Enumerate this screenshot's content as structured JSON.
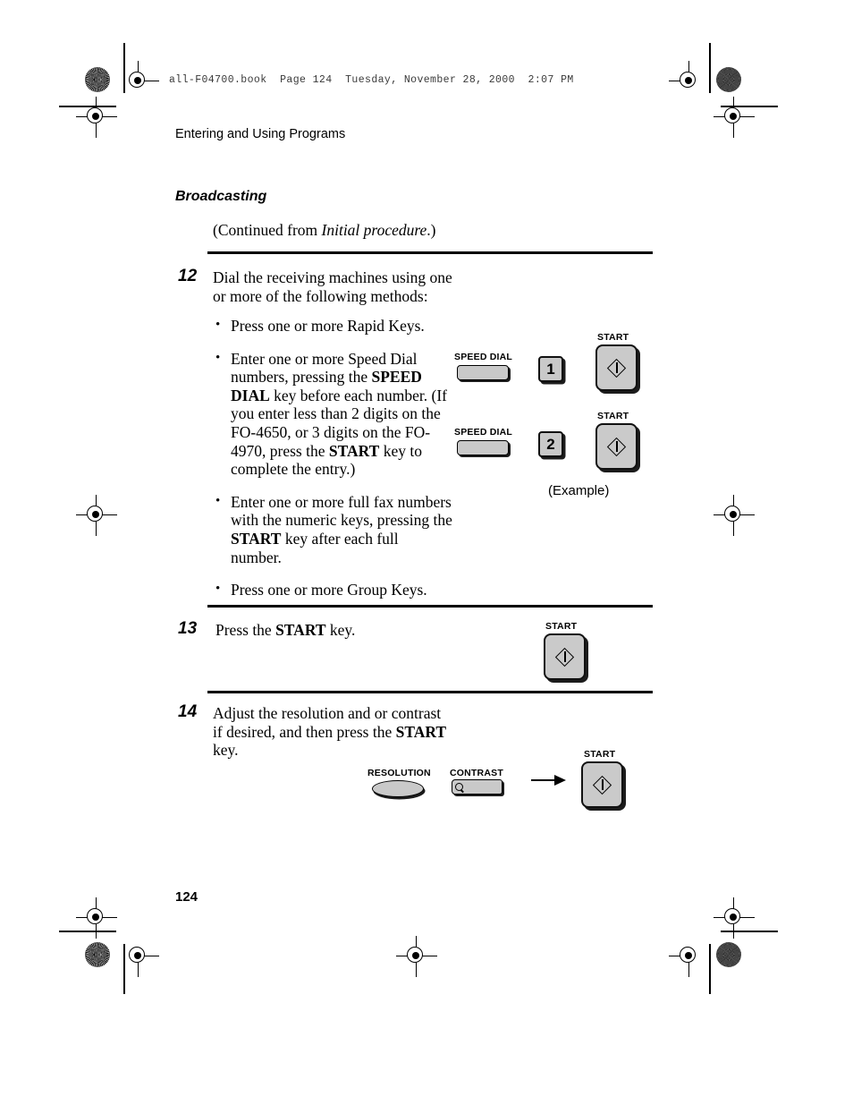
{
  "print_header": "all-F04700.book  Page 124  Tuesday, November 28, 2000  2:07 PM",
  "running_head": "Entering and Using Programs",
  "section_title": "Broadcasting",
  "continued_note": {
    "prefix": "(Continued from ",
    "italic": "Initial procedure",
    "suffix": ".)"
  },
  "folio": "124",
  "steps": [
    {
      "number": "12",
      "lead_line_1": "Dial the receiving machines using one",
      "lead_line_2": "or more of the following methods:",
      "bullets": [
        {
          "parts": [
            {
              "text": "Press one or more Rapid Keys.",
              "bold": false
            }
          ]
        },
        {
          "parts": [
            {
              "text": "Enter one or more Speed Dial numbers, pressing the ",
              "bold": false
            },
            {
              "text": "SPEED DIAL",
              "bold": true
            },
            {
              "text": " key before each number. (If you enter less than 2 digits on the FO-4650, or 3 digits on the FO-4970, press the ",
              "bold": false
            },
            {
              "text": "START",
              "bold": true
            },
            {
              "text": " key to complete the entry.)",
              "bold": false
            }
          ]
        },
        {
          "parts": [
            {
              "text": "Enter one or more full fax numbers with the numeric keys, pressing the ",
              "bold": false
            },
            {
              "text": "START",
              "bold": true
            },
            {
              "text": " key after each full number.",
              "bold": false
            }
          ]
        },
        {
          "parts": [
            {
              "text": "Press one or more Group Keys.",
              "bold": false
            }
          ]
        }
      ]
    },
    {
      "number": "13",
      "parts": [
        {
          "text": "Press the ",
          "bold": false
        },
        {
          "text": "START",
          "bold": true
        },
        {
          "text": " key.",
          "bold": false
        }
      ]
    },
    {
      "number": "14",
      "parts": [
        {
          "text": "Adjust the resolution and or contrast if desired, and then press the ",
          "bold": false
        },
        {
          "text": "START",
          "bold": true
        },
        {
          "text": " key.",
          "bold": false
        }
      ]
    }
  ],
  "keys": {
    "speed_dial_label": "SPEED DIAL",
    "start_label": "START",
    "resolution_label": "RESOLUTION",
    "contrast_label": "CONTRAST",
    "numeric_1": "1",
    "numeric_2": "2",
    "example_caption": "(Example)"
  }
}
